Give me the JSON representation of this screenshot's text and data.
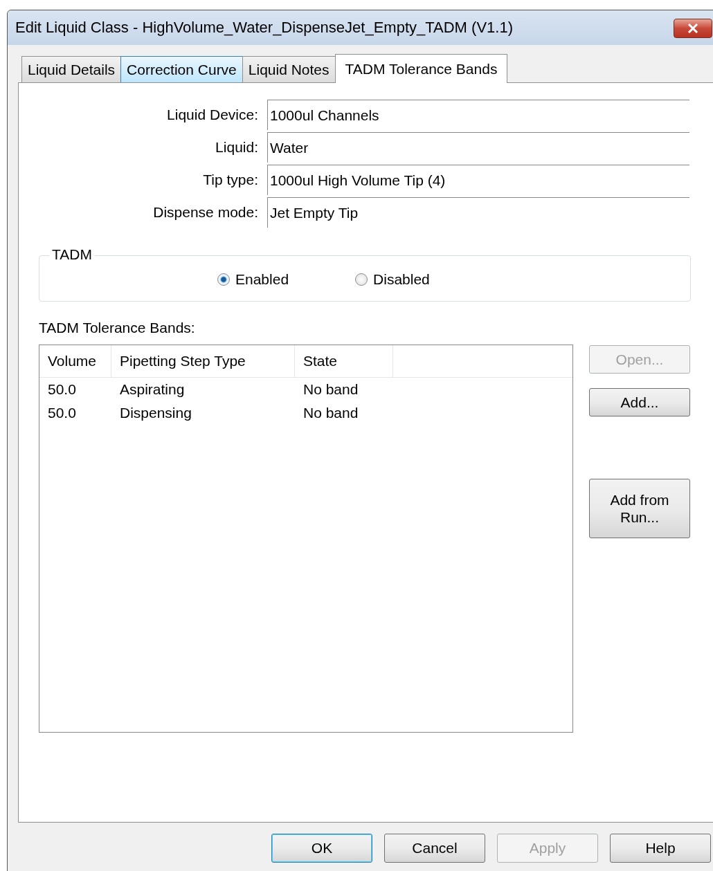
{
  "window": {
    "title": "Edit Liquid Class - HighVolume_Water_DispenseJet_Empty_TADM (V1.1)"
  },
  "tabs": [
    {
      "label": "Liquid Details",
      "selected": false,
      "hovered": false
    },
    {
      "label": "Correction Curve",
      "selected": false,
      "hovered": true
    },
    {
      "label": "Liquid Notes",
      "selected": false,
      "hovered": false
    },
    {
      "label": "TADM Tolerance Bands",
      "selected": true,
      "hovered": false
    }
  ],
  "fields": [
    {
      "label": "Liquid Device:",
      "value": "1000ul Channels"
    },
    {
      "label": "Liquid:",
      "value": "Water"
    },
    {
      "label": "Tip type:",
      "value": "1000ul High Volume Tip (4)"
    },
    {
      "label": "Dispense mode:",
      "value": "Jet Empty Tip"
    }
  ],
  "tadm_group": {
    "title": "TADM",
    "options": [
      {
        "label": "Enabled",
        "selected": true
      },
      {
        "label": "Disabled",
        "selected": false
      }
    ]
  },
  "bands": {
    "label": "TADM Tolerance Bands:",
    "columns": [
      "Volume",
      "Pipetting Step Type",
      "State"
    ],
    "rows": [
      [
        "50.0",
        "Aspirating",
        "No band"
      ],
      [
        "50.0",
        "Dispensing",
        "No band"
      ]
    ]
  },
  "side_buttons": [
    {
      "label": "Open...",
      "disabled": true
    },
    {
      "label": "Add...",
      "disabled": false
    },
    {
      "label": "Add from Run...",
      "disabled": false
    }
  ],
  "footer_buttons": [
    {
      "label": "OK",
      "disabled": false,
      "default": true
    },
    {
      "label": "Cancel",
      "disabled": false,
      "default": false
    },
    {
      "label": "Apply",
      "disabled": true,
      "default": false
    },
    {
      "label": "Help",
      "disabled": false,
      "default": false
    }
  ]
}
